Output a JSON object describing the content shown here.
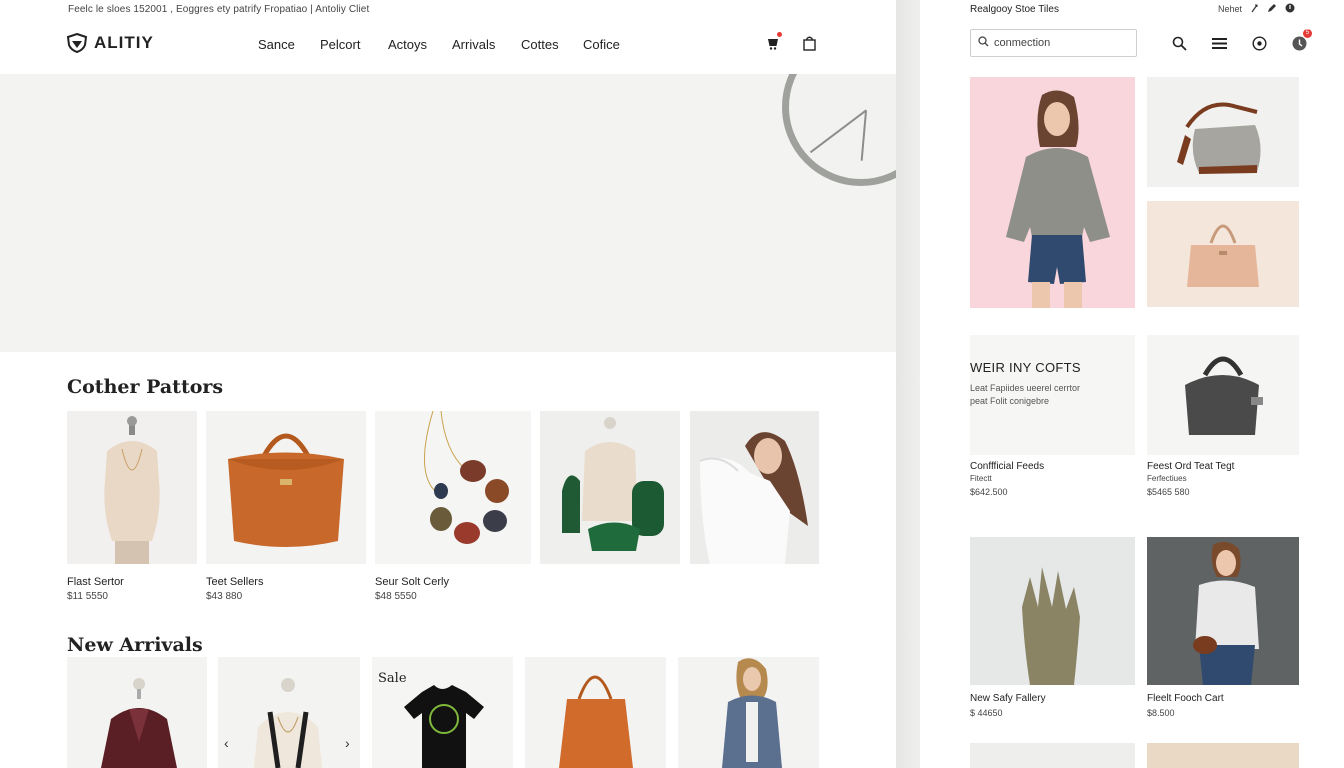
{
  "announcement": "Feelc le sloes 152001 , Eoggres ety patrify Fropatiao | Antoliy Cliet",
  "brand": {
    "name": "ALITIY"
  },
  "nav": [
    "Sance",
    "Pelcort",
    "Actoys",
    "Arrivals",
    "Cottes",
    "Cofice"
  ],
  "sections": {
    "best_title": "Cother Pattors",
    "new_title": "New Arrivals",
    "sale_label": "Sale"
  },
  "best_products": [
    {
      "name": "Flast Sertor",
      "price": "$11 5550"
    },
    {
      "name": "Teet Sellers",
      "price": "$43 880"
    },
    {
      "name": "Seur Solt Cerly",
      "price": "$48 5550"
    }
  ],
  "right": {
    "title": "Realgooy Stoe Tiles",
    "top_right_text": "Nehet",
    "search_value": "conmection",
    "badge_count": "5",
    "promo": {
      "title": "WEIR INY COFTS",
      "subtitle": "Leat Fapiides ueerel cerrtor peat Folit conigebre"
    },
    "products": [
      {
        "name": "Conffficial Feeds",
        "sub": "Fitectt",
        "price": "$642.500"
      },
      {
        "name": "Feest Ord Teat Tegt",
        "sub": "Ferfectiues",
        "price": "$5465 580"
      },
      {
        "name": "New Safy Fallery",
        "sub": "",
        "price": "$ 44650"
      },
      {
        "name": "Fleelt Fooch Cart",
        "sub": "",
        "price": "$8.500"
      }
    ]
  },
  "colors": {
    "hero_bg": "#f3f3f2",
    "pink_bg": "#f8d6dc",
    "accent_red": "#e53935"
  }
}
